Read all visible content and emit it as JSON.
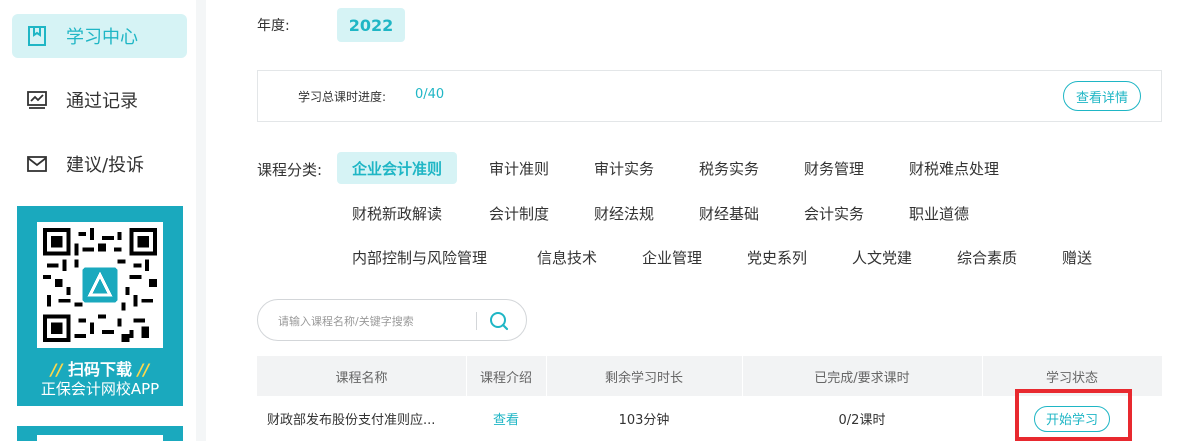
{
  "sidebar": {
    "items": [
      {
        "label": "学习中心",
        "icon": "book-icon",
        "active": true
      },
      {
        "label": "通过记录",
        "icon": "chart-icon",
        "active": false
      },
      {
        "label": "建议/投诉",
        "icon": "mail-icon",
        "active": false
      }
    ],
    "promo": {
      "title": "扫码下载",
      "slash": "//",
      "subtitle": "正保会计网校APP",
      "bg_color": "#1aa9be"
    }
  },
  "year": {
    "label": "年度:",
    "value": "2022"
  },
  "progress": {
    "label": "学习总课时进度:",
    "value": "0/40",
    "detail_button": "查看详情"
  },
  "categories": {
    "label": "课程分类:",
    "items": [
      "企业会计准则",
      "审计准则",
      "审计实务",
      "税务实务",
      "财务管理",
      "财税难点处理",
      "财税新政解读",
      "会计制度",
      "财经法规",
      "财经基础",
      "会计实务",
      "职业道德",
      "内部控制与风险管理",
      "信息技术",
      "企业管理",
      "党史系列",
      "人文党建",
      "综合素质",
      "赠送"
    ],
    "active": "企业会计准则"
  },
  "search": {
    "placeholder": "请输入课程名称/关键字搜索",
    "icon": "search-icon"
  },
  "table": {
    "headers": [
      "课程名称",
      "课程介绍",
      "剩余学习时长",
      "已完成/要求课时",
      "学习状态"
    ],
    "rows": [
      {
        "name": "财政部发布股份支付准则应...",
        "intro": "查看",
        "remaining": "103分钟",
        "progress": "0/2课时",
        "status": "开始学习"
      }
    ]
  },
  "colors": {
    "accent": "#1fb6c5",
    "accent_bg": "#d6f3f5",
    "highlight_box": "#e8292f"
  }
}
